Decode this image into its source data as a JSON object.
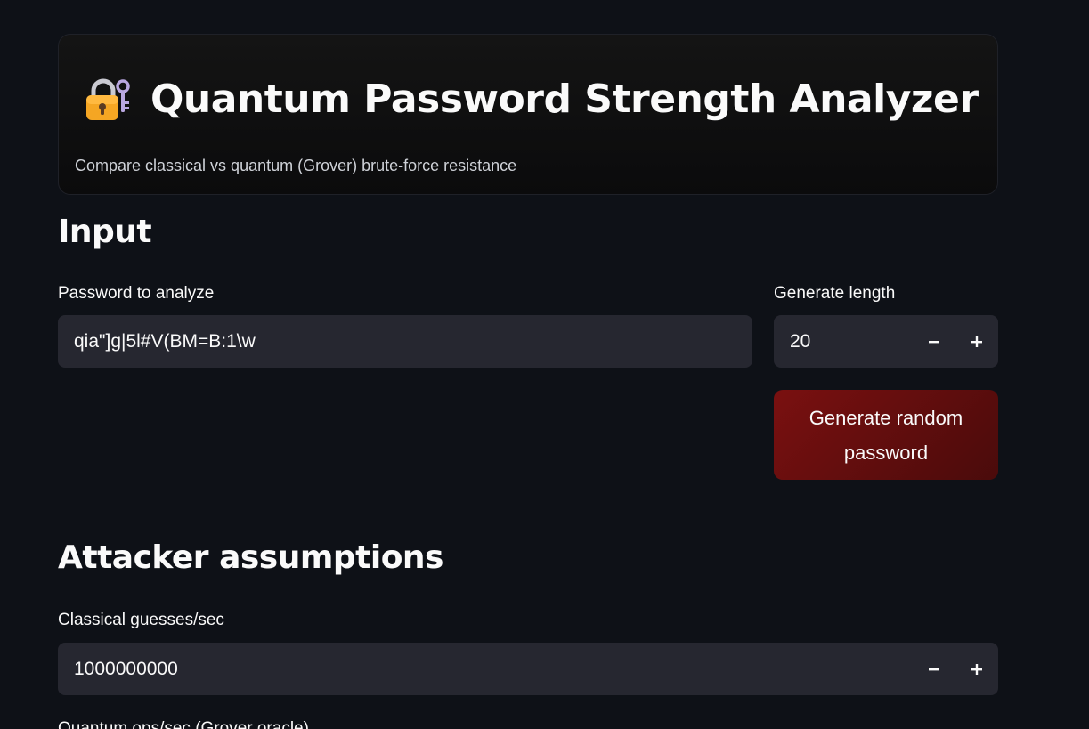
{
  "header": {
    "icon": "locked-with-key-icon",
    "title": "Quantum Password Strength Analyzer",
    "subtitle": "Compare classical vs quantum (Grover) brute-force resistance"
  },
  "input_section": {
    "heading": "Input",
    "password_label": "Password to analyze",
    "password_value": "qia\"]g|5l#V(BM=B:1\\w",
    "length_label": "Generate length",
    "length_value": "20",
    "generate_button": "Generate random password"
  },
  "attacker_section": {
    "heading": "Attacker assumptions",
    "classical_label": "Classical guesses/sec",
    "classical_value": "1000000000",
    "quantum_label_partial": "Quantum ops/sec (Grover oracle)"
  },
  "colors": {
    "background": "#0e1117",
    "input_bg": "#262730",
    "button_gradient_start": "#7a1010",
    "button_gradient_end": "#4a0b0b"
  }
}
